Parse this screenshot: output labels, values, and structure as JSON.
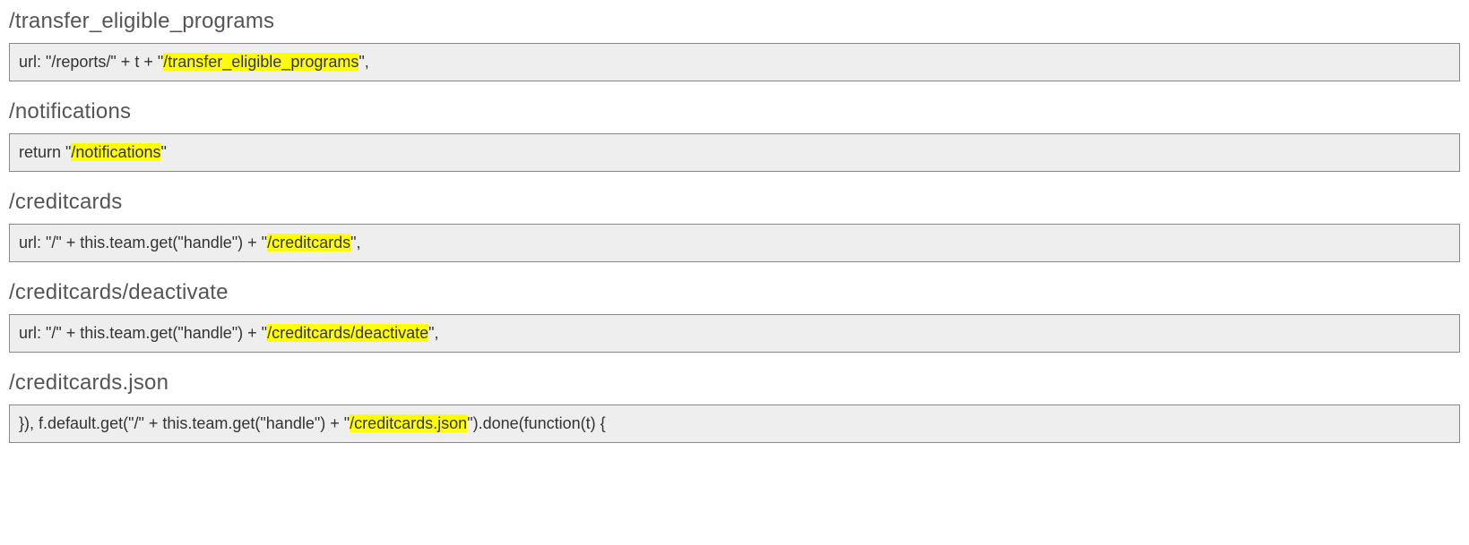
{
  "sections": [
    {
      "heading": "/transfer_eligible_programs",
      "code_pre": "url: \"/reports/\" + t + \"",
      "code_hl": "/transfer_eligible_programs",
      "code_post": "\","
    },
    {
      "heading": "/notifications",
      "code_pre": "return \"",
      "code_hl": "/notifications",
      "code_post": "\""
    },
    {
      "heading": "/creditcards",
      "code_pre": "url: \"/\" + this.team.get(\"handle\") + \"",
      "code_hl": "/creditcards",
      "code_post": "\","
    },
    {
      "heading": "/creditcards/deactivate",
      "code_pre": "url: \"/\" + this.team.get(\"handle\") + \"",
      "code_hl": "/creditcards/deactivate",
      "code_post": "\","
    },
    {
      "heading": "/creditcards.json",
      "code_pre": "}), f.default.get(\"/\" + this.team.get(\"handle\") + \"",
      "code_hl": "/creditcards.json",
      "code_post": "\").done(function(t) {"
    }
  ]
}
